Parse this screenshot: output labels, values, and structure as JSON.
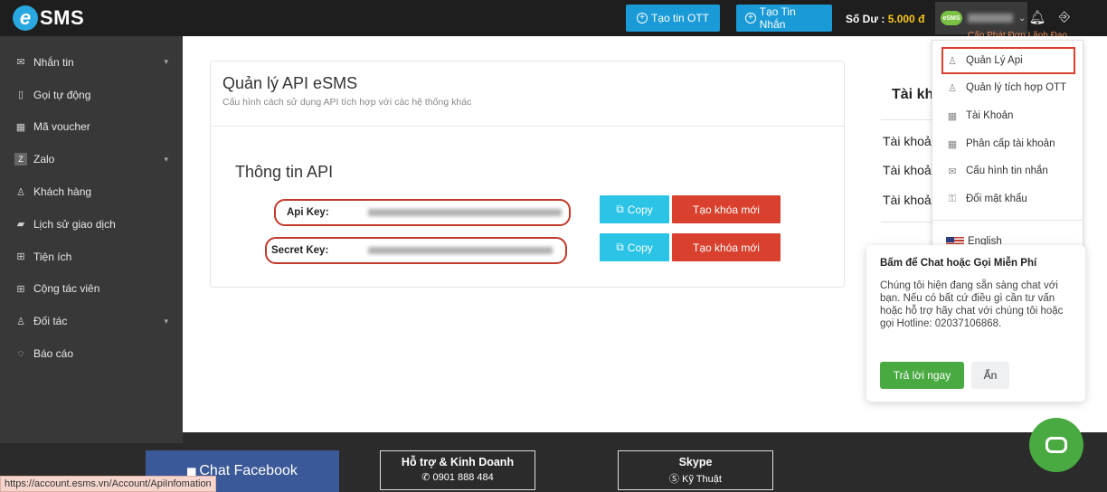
{
  "app": {
    "logo_text": "SMS",
    "logo_letter": "e",
    "mini_logo": "eSMS"
  },
  "topbar": {
    "btn_ott": "Tạo tin OTT",
    "btn_message": "Tạo Tin Nhắn",
    "balance_label": "Số Dư :",
    "balance_amount": "5.000 đ",
    "icons": [
      "bell-icon",
      "logout-icon"
    ],
    "subnote": "Cấp Phát Đơn Lãnh Đạo"
  },
  "sidebar": {
    "items": [
      {
        "label": "Nhắn tin",
        "icon": "mail-icon",
        "has_arrow": true
      },
      {
        "label": "Gọi tự động",
        "icon": "phone-icon",
        "has_arrow": false
      },
      {
        "label": "Mã voucher",
        "icon": "gift-icon",
        "has_arrow": false
      },
      {
        "label": "Zalo",
        "icon": "zalo-icon",
        "has_arrow": true
      },
      {
        "label": "Khách hàng",
        "icon": "user-icon",
        "has_arrow": false
      },
      {
        "label": "Lịch sử giao dịch",
        "icon": "book-icon",
        "has_arrow": false
      },
      {
        "label": "Tiện ích",
        "icon": "tools-icon",
        "has_arrow": false
      },
      {
        "label": "Cộng tác viên",
        "icon": "team-icon",
        "has_arrow": false
      },
      {
        "label": "Đối tác",
        "icon": "partner-icon",
        "has_arrow": true
      },
      {
        "label": "Báo cáo",
        "icon": "report-icon",
        "has_arrow": false
      }
    ]
  },
  "card": {
    "title": "Quản lý API eSMS",
    "subtitle": "Cấu hình cách sử dụng API tích hợp với các hệ thống khác",
    "section_title": "Thông tin API",
    "api_key_label": "Api Key:",
    "secret_key_label": "Secret Key:",
    "copy_label": "Copy",
    "new_key_label": "Tạo khóa mới"
  },
  "right_info": {
    "title": "Tài kh",
    "rows": [
      "Tài khoả",
      "Tài khoả",
      "Tài khoả"
    ]
  },
  "dropdown": {
    "items": [
      {
        "label": "Quản Lý Api",
        "icon": "user-icon"
      },
      {
        "label": "Quản lý tích hợp OTT",
        "icon": "user-icon"
      },
      {
        "label": "Tài Khoản",
        "icon": "calendar-icon"
      },
      {
        "label": "Phân cấp tài khoản",
        "icon": "calendar-icon"
      },
      {
        "label": "Cấu hình tin nhắn",
        "icon": "envelope-open-icon"
      },
      {
        "label": "Đổi mật khẩu",
        "icon": "key-icon"
      }
    ],
    "language": "English"
  },
  "chat_popup": {
    "title": "Bấm để Chat hoặc Gọi Miễn Phí",
    "body": "Chúng tôi hiện đang sẵn sàng chat với bạn. Nếu có bất cứ điều gì cần tư vấn hoặc hỗ trợ hãy chat với chúng tôi hoặc gọi Hotline: 02037106868.",
    "reply_label": "Trả lời ngay",
    "hide_label": "Ẩn"
  },
  "footer": {
    "facebook": "Chat Facebook",
    "support_title": "Hỗ trợ & Kinh Doanh",
    "support_phone": "0901 888 484",
    "skype_title": "Skype",
    "skype_sub": "Kỹ Thuật"
  },
  "status_url": "https://account.esms.vn/Account/ApiInfomation",
  "colors": {
    "topbar": "#1e1e1e",
    "sidebar": "#383838",
    "accent_blue": "#1a9ad6",
    "copy_cyan": "#2bc4e6",
    "danger_red": "#d9412e",
    "green": "#4aaa42",
    "facebook": "#3b5998"
  }
}
